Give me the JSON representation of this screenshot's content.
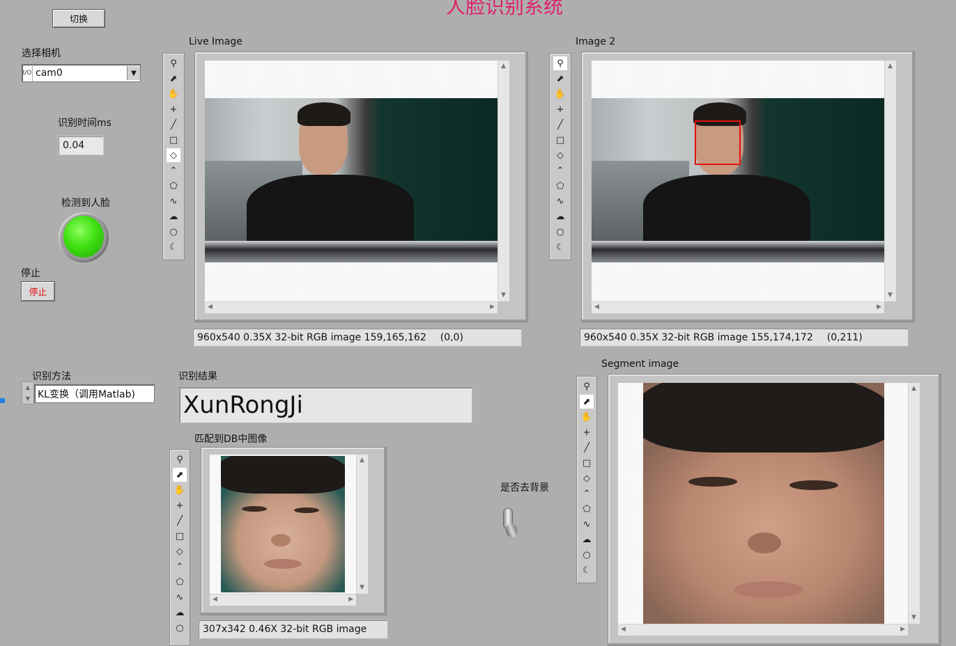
{
  "app": {
    "title": "人脸识别系统",
    "switch_label": "切换",
    "camera_label": "选择相机",
    "camera_value": "cam0",
    "camera_prefix": "I/O",
    "time_label": "识别时间ms",
    "time_value": "0.04",
    "face_detected_label": "检测到人脸",
    "face_detected_led": "on",
    "stop_label": "停止",
    "stop_button": "停止",
    "method_label": "识别方法",
    "method_value": "KL变换（调用Matlab)",
    "result_label": "识别结果",
    "result_value": "XunRongJi",
    "db_label": "匹配到DB中图像",
    "remove_bg_label": "是否去背景"
  },
  "displays": {
    "live": {
      "label": "Live Image",
      "status": "960x540 0.35X 32-bit RGB image 159,165,162",
      "coord": "(0,0)"
    },
    "image2": {
      "label": "Image 2",
      "status": "960x540 0.35X 32-bit RGB image 155,174,172",
      "coord": "(0,211)"
    },
    "segment": {
      "label": "Segment image"
    },
    "db": {
      "status": "307x342 0.46X 32-bit RGB image"
    }
  },
  "tools": [
    "zoom-icon",
    "pointer-icon",
    "pan-icon",
    "crosshair-icon",
    "line-icon",
    "rectangle-icon",
    "rotated-rect-icon",
    "polyline-icon",
    "polygon-icon",
    "freehand-line-icon",
    "freehand-region-icon",
    "oval-icon",
    "annulus-icon"
  ],
  "colors": {
    "title": "#e0206a",
    "led": "#3fe010",
    "stop_text": "#e01010",
    "face_box": "#e01010"
  }
}
